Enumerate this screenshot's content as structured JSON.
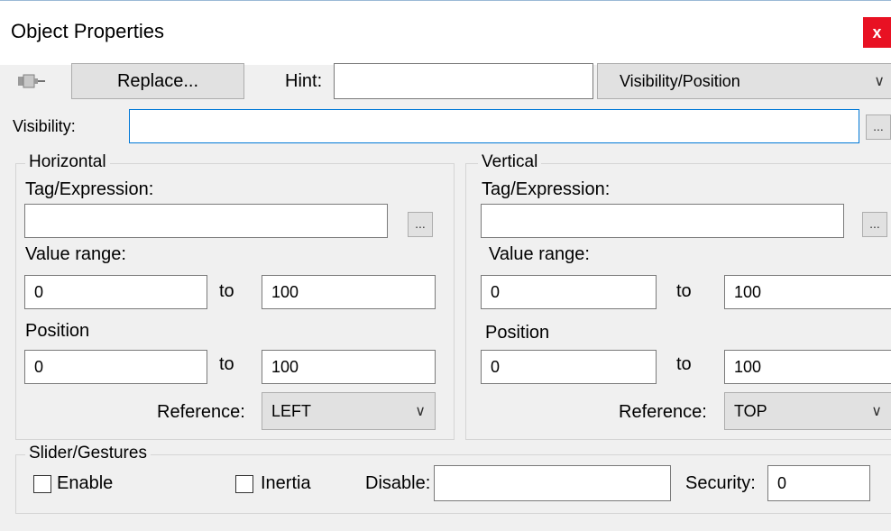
{
  "window": {
    "title": "Object Properties",
    "close_glyph": "x"
  },
  "toolbar": {
    "pin_icon": "pushpin-icon",
    "replace_label": "Replace...",
    "hint_label": "Hint:",
    "hint_value": "",
    "mode_select": "Visibility/Position"
  },
  "visibility": {
    "label": "Visibility:",
    "value": "",
    "browse_label": "..."
  },
  "horizontal": {
    "title": "Horizontal",
    "tag_label": "Tag/Expression:",
    "tag_value": "",
    "browse_label": "...",
    "value_range_label": "Value range:",
    "range_from": "0",
    "range_to": "100",
    "to_label": "to",
    "position_label": "Position",
    "pos_from": "0",
    "pos_to": "100",
    "reference_label": "Reference:",
    "reference_value": "LEFT"
  },
  "vertical": {
    "title": "Vertical",
    "tag_label": "Tag/Expression:",
    "tag_value": "",
    "browse_label": "...",
    "value_range_label": "Value range:",
    "range_from": "0",
    "range_to": "100",
    "to_label": "to",
    "position_label": "Position",
    "pos_from": "0",
    "pos_to": "100",
    "reference_label": "Reference:",
    "reference_value": "TOP"
  },
  "slider": {
    "title": "Slider/Gestures",
    "enable_label": "Enable",
    "enable_checked": false,
    "inertia_label": "Inertia",
    "inertia_checked": false,
    "disable_label": "Disable:",
    "disable_value": "",
    "security_label": "Security:",
    "security_value": "0"
  }
}
